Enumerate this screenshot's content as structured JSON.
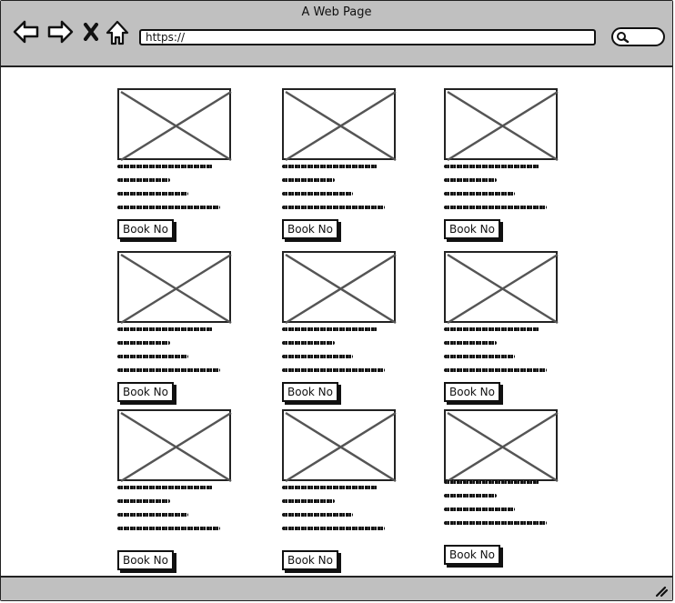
{
  "browser": {
    "title": "A Web Page",
    "url": "https://",
    "icons": [
      "back-arrow-icon",
      "forward-arrow-icon",
      "close-x-icon",
      "home-icon",
      "search-icon",
      "resize-grip-icon"
    ]
  },
  "cards": [
    {
      "button": "Book No"
    },
    {
      "button": "Book No"
    },
    {
      "button": "Book No"
    },
    {
      "button": "Book No"
    },
    {
      "button": "Book No"
    },
    {
      "button": "Book No"
    },
    {
      "button": "Book No"
    },
    {
      "button": "Book No"
    },
    {
      "button": "Book No"
    }
  ]
}
